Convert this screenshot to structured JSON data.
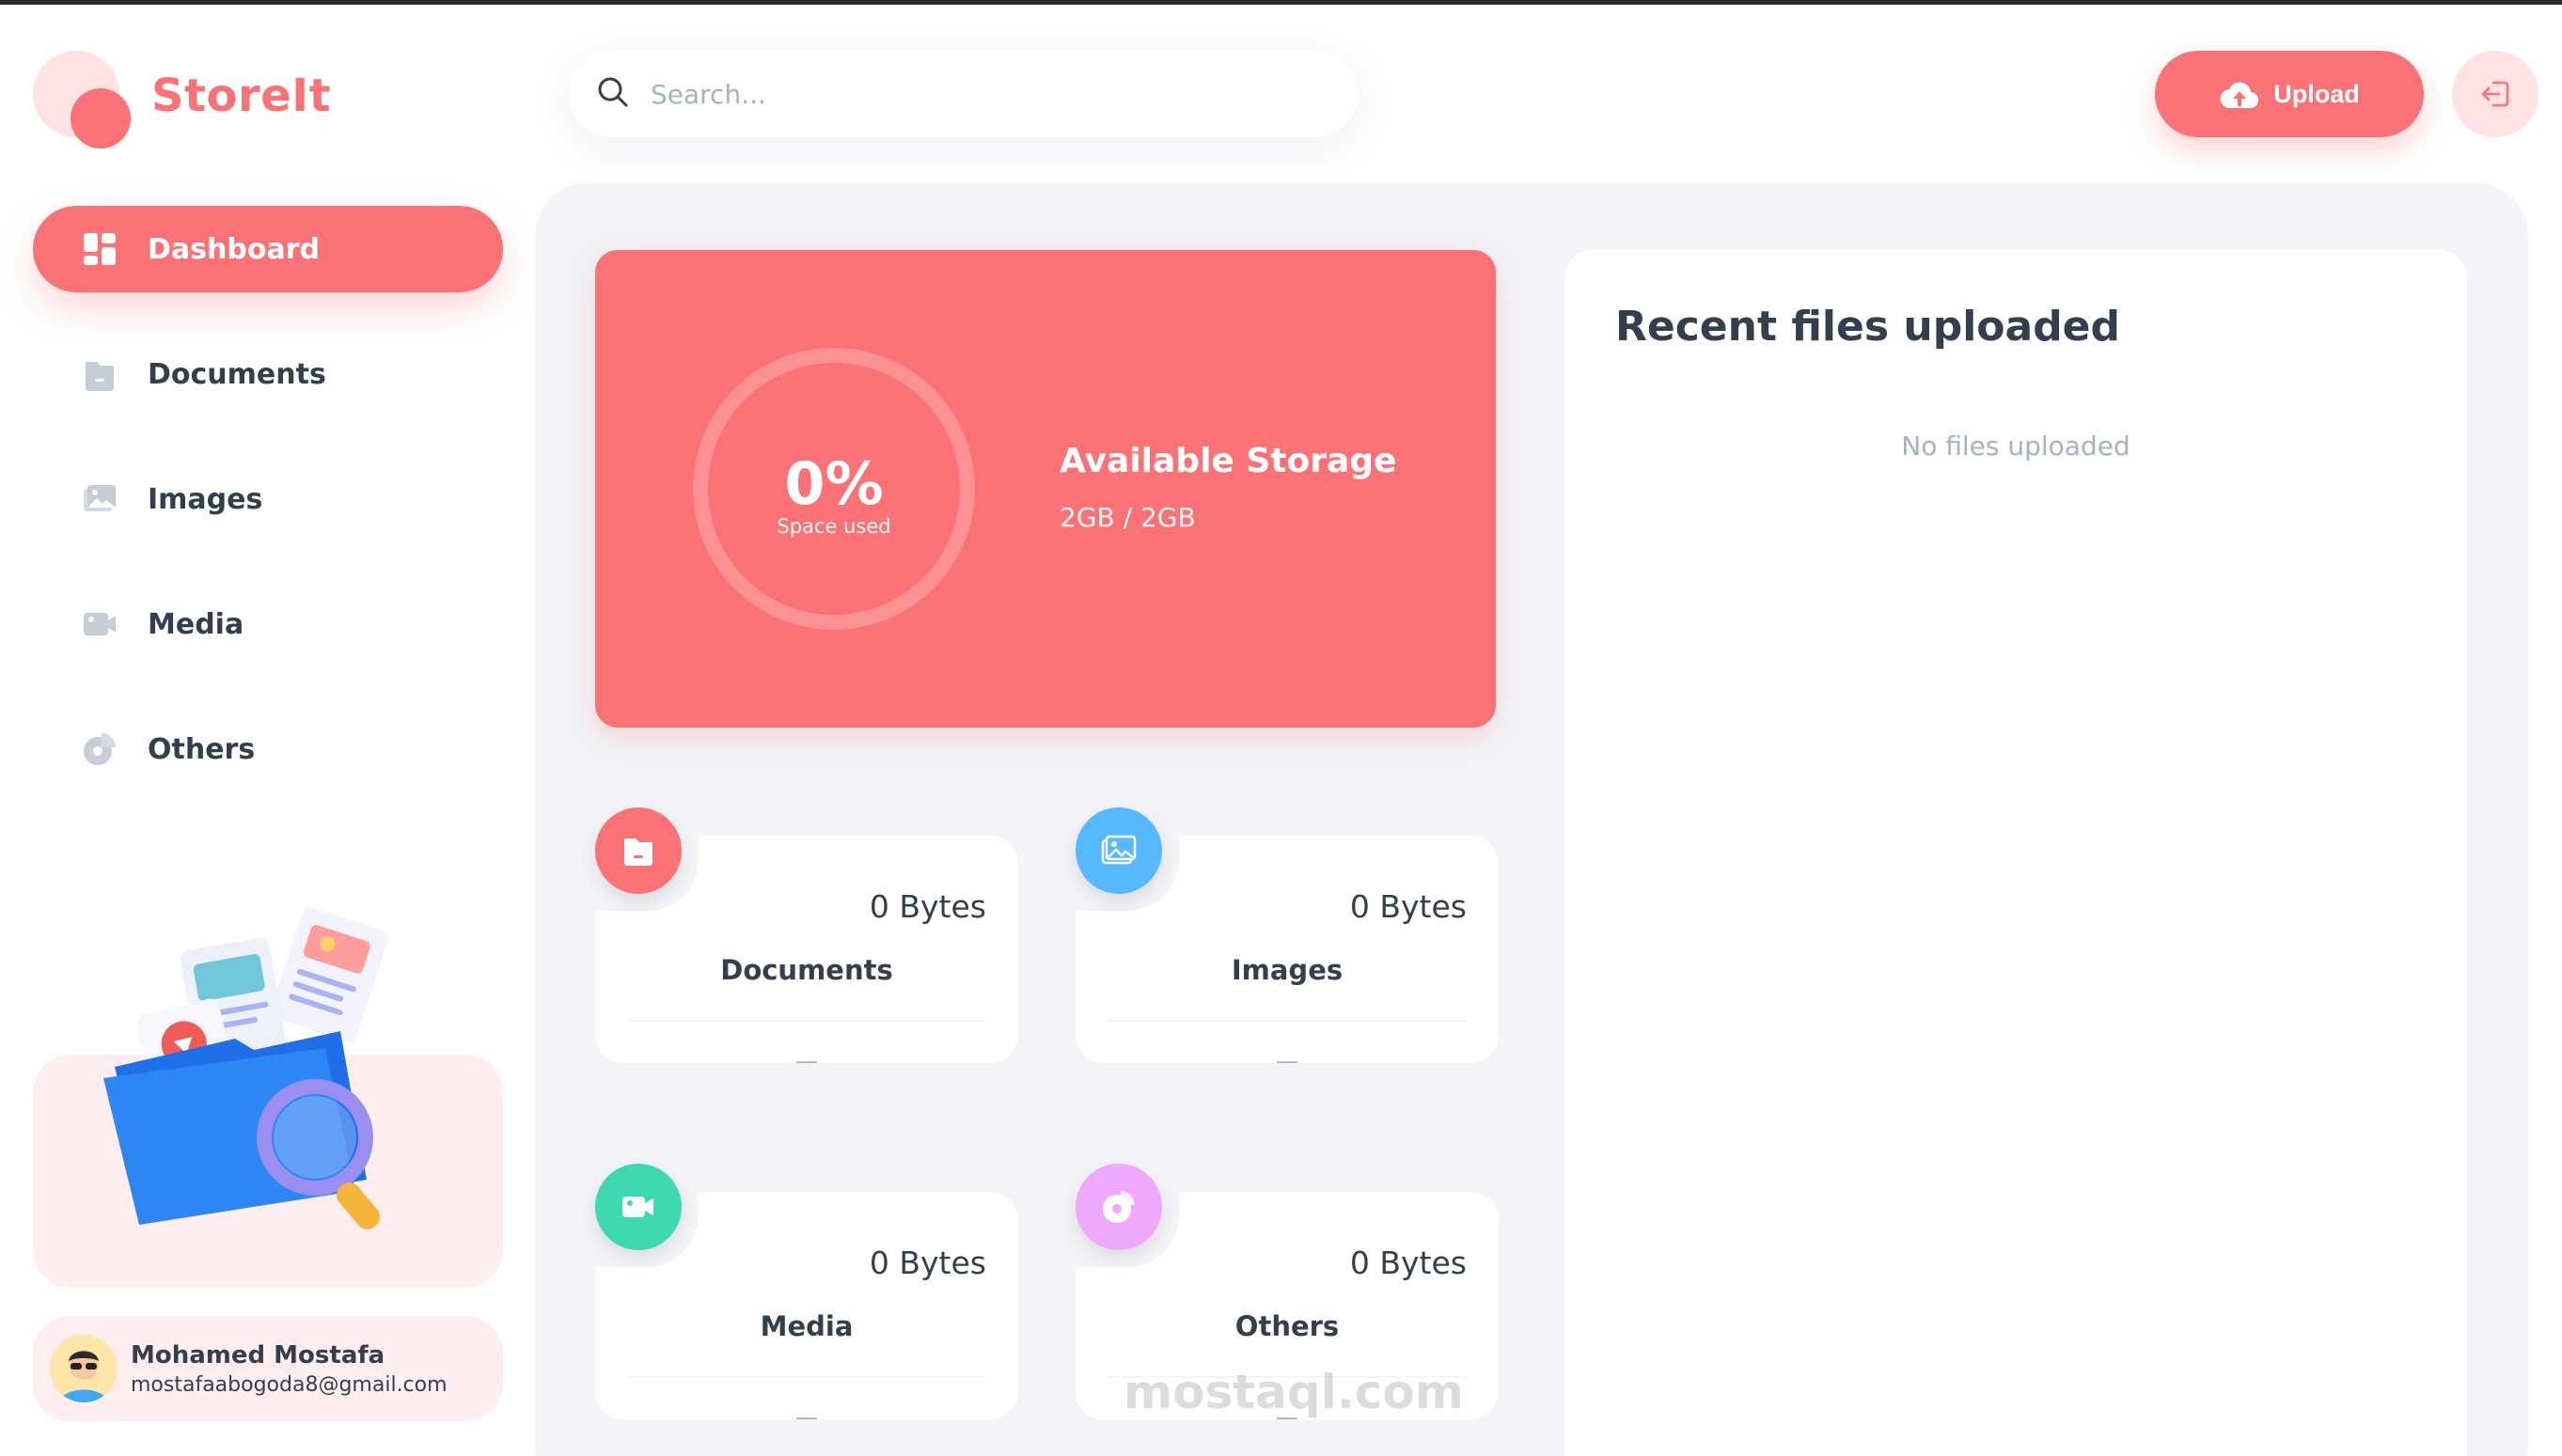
{
  "brand": {
    "name": "StoreIt"
  },
  "sidebar": {
    "items": [
      {
        "label": "Dashboard",
        "icon": "dashboard-icon",
        "active": true
      },
      {
        "label": "Documents",
        "icon": "documents-icon",
        "active": false
      },
      {
        "label": "Images",
        "icon": "images-icon",
        "active": false
      },
      {
        "label": "Media",
        "icon": "media-icon",
        "active": false
      },
      {
        "label": "Others",
        "icon": "others-icon",
        "active": false
      }
    ]
  },
  "user": {
    "name": "Mohamed Mostafa",
    "email": "mostafaabogoda8@gmail.com"
  },
  "header": {
    "search_placeholder": "Search...",
    "upload_label": "Upload",
    "logout_icon": "logout-icon"
  },
  "storage": {
    "percent_label": "0%",
    "percent_value": 0,
    "subtitle": "Space used",
    "title": "Available Storage",
    "value": "2GB / 2GB"
  },
  "cards": [
    {
      "bytes": "0 Bytes",
      "title": "Documents",
      "date": "—",
      "color": "#FA7275",
      "icon": "documents-icon"
    },
    {
      "bytes": "0 Bytes",
      "title": "Images",
      "date": "—",
      "color": "#56B8FF",
      "icon": "images-icon"
    },
    {
      "bytes": "0 Bytes",
      "title": "Media",
      "date": "—",
      "color": "#3DD9B3",
      "icon": "video-icon"
    },
    {
      "bytes": "0 Bytes",
      "title": "Others",
      "date": "—",
      "color": "#EEA8FD",
      "icon": "pie-chart-icon"
    }
  ],
  "recent": {
    "title": "Recent files uploaded",
    "empty": "No files uploaded"
  },
  "watermark": {
    "text": "mostaql.com"
  },
  "colors": {
    "brand": "#FA7275",
    "brand_light": "#FFE3E4",
    "panel": "#F2F4F8",
    "text": "#333F4E",
    "muted": "#A3B2C7"
  }
}
